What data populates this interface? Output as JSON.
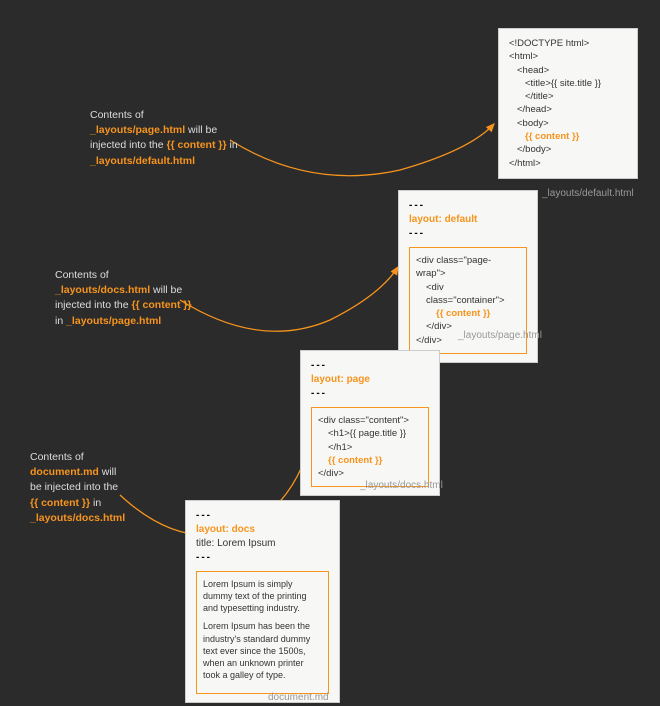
{
  "boxes": {
    "default": {
      "lines": [
        "<!DOCTYPE html>",
        "<html>",
        "<head>",
        "<title>{{ site.title }}</title>",
        "</head>",
        "<body>",
        "{{ content }}",
        "</body>",
        "</html>"
      ],
      "path": "_layouts/default.html"
    },
    "page": {
      "sep": "---",
      "layout_key": "layout:",
      "layout_val": "default",
      "lines": [
        "<div class=\"page-wrap\">",
        "<div class=\"container\">",
        "{{ content }}",
        "</div>",
        "</div>"
      ],
      "path": "_layouts/page.html"
    },
    "docs": {
      "sep": "---",
      "layout_key": "layout:",
      "layout_val": "page",
      "lines": [
        "<div class=\"content\">",
        "<h1>{{ page.title }}</h1>",
        "{{ content }}",
        "</div>"
      ],
      "path": "_layouts/docs.html"
    },
    "doc": {
      "sep": "---",
      "layout_key": "layout:",
      "layout_val": "docs",
      "title_key": "title:",
      "title_val": "Lorem Ipsum",
      "p1": "Lorem Ipsum is simply dummy text of the printing and typesetting industry.",
      "p2": "Lorem Ipsum has been the industry's standard dummy text ever since the 1500s, when an unknown printer took a galley of type.",
      "path": "document.md"
    }
  },
  "annotations": {
    "a1": {
      "pre": "Contents of",
      "file": "_layouts/page.html",
      "mid1": " will be",
      "mid2": "injected into the ",
      "tag": "{{ content }}",
      "mid3": " in",
      "target": "_layouts/default.html"
    },
    "a2": {
      "pre": "Contents of",
      "file": "_layouts/docs.html",
      "mid1": " will be",
      "mid2": "injected into the ",
      "tag": "{{ content }}",
      "mid3": "in ",
      "target": "_layouts/page.html"
    },
    "a3": {
      "pre": "Contents of",
      "file": "document.md",
      "mid1": " will",
      "mid2": "be injected into the",
      "tag": "{{ content }}",
      "mid3": " in",
      "target": "_layouts/docs.html"
    }
  }
}
